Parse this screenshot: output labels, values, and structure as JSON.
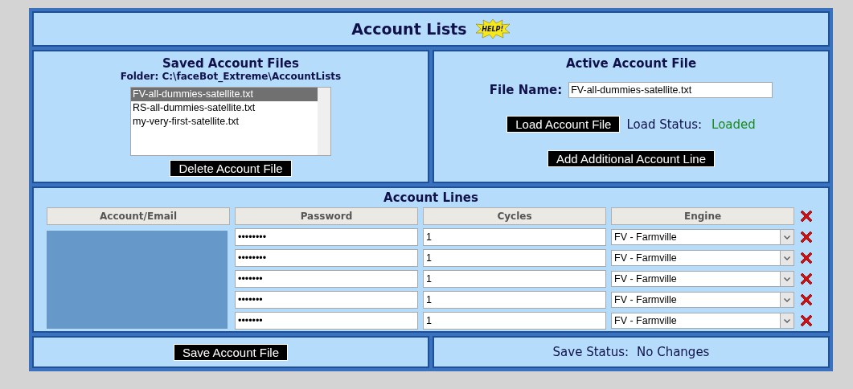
{
  "title": "Account Lists",
  "help_badge": "HELP!",
  "saved_files": {
    "heading": "Saved Account Files",
    "folder": "Folder: C:\\faceBot_Extreme\\AccountLists",
    "files": [
      {
        "name": "FV-all-dummies-satellite.txt",
        "selected": true
      },
      {
        "name": "RS-all-dummies-satellite.txt",
        "selected": false
      },
      {
        "name": "my-very-first-satellite.txt",
        "selected": false
      }
    ],
    "delete_button": "Delete Account File"
  },
  "active_file": {
    "heading": "Active Account File",
    "file_name_label": "File Name:",
    "file_name": "FV-all-dummies-satellite.txt",
    "load_button": "Load Account File",
    "load_status_label": "Load Status:",
    "load_status": "Loaded",
    "add_button": "Add Additional Account Line"
  },
  "account_lines": {
    "heading": "Account Lines",
    "columns": [
      "Account/Email",
      "Password",
      "Cycles",
      "Engine"
    ],
    "rows": [
      {
        "password": "••••••••",
        "cycles": "1",
        "engine": "FV - Farmville"
      },
      {
        "password": "••••••••",
        "cycles": "1",
        "engine": "FV - Farmville"
      },
      {
        "password": "•••••••",
        "cycles": "1",
        "engine": "FV - Farmville"
      },
      {
        "password": "•••••••",
        "cycles": "1",
        "engine": "FV - Farmville"
      },
      {
        "password": "•••••••",
        "cycles": "1",
        "engine": "FV - Farmville"
      }
    ]
  },
  "save_button": "Save Account File",
  "save_status_label": "Save Status:",
  "save_status": "No Changes"
}
